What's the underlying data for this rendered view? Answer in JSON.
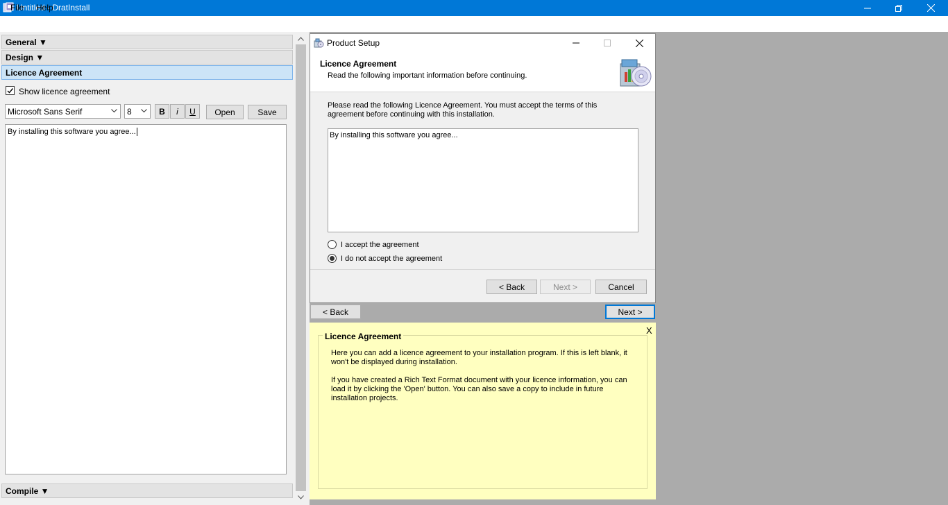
{
  "window": {
    "title": "Untitled - DratInstall",
    "icon": "app-icon",
    "controls": [
      "minimize-icon",
      "restore-icon",
      "close-icon"
    ]
  },
  "menu": {
    "file": "File",
    "help": "Help"
  },
  "sections": {
    "general": "General ▼",
    "design": "Design ▼",
    "licence": "Licence Agreement",
    "compile": "Compile ▼"
  },
  "licence_editor": {
    "show_checkbox_label": "Show licence agreement",
    "show_checked": true,
    "font_name": "Microsoft Sans Serif",
    "font_size": "8",
    "bold_label": "B",
    "italic_label": "i",
    "underline_label": "U",
    "open_label": "Open",
    "save_label": "Save",
    "text": "By installing this software you agree..."
  },
  "dialog": {
    "title": "Product Setup",
    "heading": "Licence Agreement",
    "subheading": "Read the following important information before continuing.",
    "intro": "Please read the following Licence Agreement. You must accept the terms of this agreement before continuing with this installation.",
    "licence_text": "By installing this software you agree...",
    "accept_label": "I accept the agreement",
    "decline_label": "I do not accept the agreement",
    "selected": "decline",
    "back_label": "< Back",
    "next_label": "Next >",
    "cancel_label": "Cancel"
  },
  "preview_nav": {
    "back_label": "< Back",
    "next_label": "Next >"
  },
  "help": {
    "close_label": "X",
    "title": "Licence Agreement",
    "paragraph1": "Here you can add a licence agreement to your installation program. If this is left blank, it won't be displayed during installation.",
    "paragraph2": "If you have created a Rich Text Format document with your licence information, you can load it by clicking the 'Open' button. You can also save a copy to include in future installation projects."
  },
  "colors": {
    "titlebar": "#0078d7",
    "help_background": "#ffffc0",
    "workspace": "#ababab",
    "selected_section": "#cce4f7"
  }
}
